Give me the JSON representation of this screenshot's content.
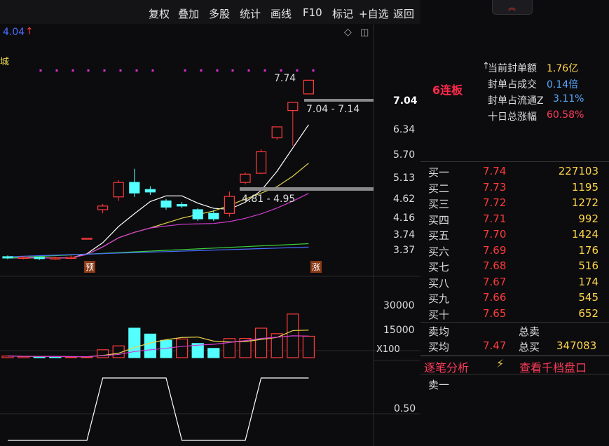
{
  "toolbar": {
    "items": [
      "复权",
      "叠加",
      "多股",
      "统计",
      "画线",
      "F10",
      "标记",
      "+自选",
      "返回"
    ]
  },
  "chart": {
    "top_price_label": "4.04",
    "top_left_char": "城",
    "price_ticks": [
      "7.04",
      "6.34",
      "5.70",
      "5.13",
      "4.62",
      "4.16",
      "3.74",
      "3.37"
    ],
    "annotation_high": "7.74",
    "range_label_1": "7.04 - 7.14",
    "range_label_2": "4.81 - 4.95",
    "marker_yu": "预",
    "marker_zhang": "涨",
    "volume_ticks": [
      "30000",
      "15000"
    ],
    "volume_unit": "X100",
    "indicator_tick": "0.50",
    "colors": {
      "up": "#ff3b3b",
      "down": "#54ffff",
      "ma5": "#ffffff",
      "ma10": "#e6d44a",
      "ma20": "#d23cd2",
      "ma60": "#3cd23c",
      "ma120": "#4a6cff",
      "dots": "#e030e0"
    }
  },
  "chart_data": {
    "type": "candlestick",
    "title": "",
    "candles": [
      {
        "open": 3.64,
        "close": 3.62,
        "high": 3.66,
        "low": 3.6
      },
      {
        "open": 3.62,
        "close": 3.63,
        "high": 3.65,
        "low": 3.6
      },
      {
        "open": 3.63,
        "close": 3.61,
        "high": 3.64,
        "low": 3.59
      },
      {
        "open": 3.61,
        "close": 3.62,
        "high": 3.64,
        "low": 3.59
      },
      {
        "open": 3.62,
        "close": 3.63,
        "high": 3.66,
        "low": 3.6
      },
      {
        "open": 3.94,
        "close": 3.94,
        "high": 3.94,
        "low": 3.94
      },
      {
        "open": 4.45,
        "close": 4.52,
        "high": 4.56,
        "low": 4.38
      },
      {
        "open": 4.7,
        "close": 5.0,
        "high": 5.05,
        "low": 4.62
      },
      {
        "open": 5.0,
        "close": 4.78,
        "high": 5.3,
        "low": 4.7
      },
      {
        "open": 4.85,
        "close": 4.8,
        "high": 4.92,
        "low": 4.74
      },
      {
        "open": 4.62,
        "close": 4.5,
        "high": 4.66,
        "low": 4.45
      },
      {
        "open": 4.55,
        "close": 4.52,
        "high": 4.6,
        "low": 4.48
      },
      {
        "open": 4.45,
        "close": 4.28,
        "high": 4.48,
        "low": 4.24
      },
      {
        "open": 4.38,
        "close": 4.28,
        "high": 4.44,
        "low": 4.24
      },
      {
        "open": 4.38,
        "close": 4.71,
        "high": 4.81,
        "low": 4.32
      },
      {
        "open": 5.0,
        "close": 5.18,
        "high": 5.22,
        "low": 4.96
      },
      {
        "open": 5.2,
        "close": 5.7,
        "high": 5.76,
        "low": 5.18
      },
      {
        "open": 6.05,
        "close": 6.34,
        "high": 6.34,
        "low": 6.0
      },
      {
        "open": 6.8,
        "close": 7.04,
        "high": 7.04,
        "low": 5.85
      },
      {
        "open": 7.3,
        "close": 7.74,
        "high": 7.74,
        "low": 7.3
      }
    ],
    "volume": [
      8,
      6,
      4,
      5,
      4,
      3,
      40,
      60,
      150,
      120,
      88,
      95,
      72,
      47,
      97,
      98,
      150,
      122,
      222,
      109
    ],
    "volume_up": [
      true,
      true,
      false,
      false,
      true,
      true,
      true,
      true,
      false,
      false,
      false,
      true,
      false,
      false,
      true,
      true,
      true,
      true,
      true,
      true
    ],
    "indicator": [
      0,
      0,
      0,
      0,
      0,
      0,
      1,
      1,
      1,
      1,
      1,
      0,
      0,
      0,
      0,
      0,
      1,
      1,
      1,
      1
    ]
  },
  "panel": {
    "status_title": "6连板",
    "stats": [
      {
        "label": "当前封单额",
        "value": "1.76亿",
        "value_color": "#ffd54a"
      },
      {
        "label": "封单占成交",
        "value": "0.14倍",
        "value_color": "#58a8ff"
      },
      {
        "label": "封单占流通Z",
        "value": "3.11%",
        "value_color": "#58a8ff"
      },
      {
        "label": "十日总涨幅",
        "value": "60.58%",
        "value_color": "#ff3b5b"
      }
    ],
    "orders": [
      {
        "label": "买一",
        "price": "7.74",
        "vol": "227103"
      },
      {
        "label": "买二",
        "price": "7.73",
        "vol": "1195"
      },
      {
        "label": "买三",
        "price": "7.72",
        "vol": "1272"
      },
      {
        "label": "买四",
        "price": "7.71",
        "vol": "992"
      },
      {
        "label": "买五",
        "price": "7.70",
        "vol": "1424"
      },
      {
        "label": "买六",
        "price": "7.69",
        "vol": "176"
      },
      {
        "label": "买七",
        "price": "7.68",
        "vol": "516"
      },
      {
        "label": "买八",
        "price": "7.67",
        "vol": "174"
      },
      {
        "label": "买九",
        "price": "7.66",
        "vol": "545"
      },
      {
        "label": "买十",
        "price": "7.65",
        "vol": "652"
      }
    ],
    "sell_avg_label": "卖均",
    "total_sell_label": "总卖",
    "buy_avg_label": "买均",
    "buy_avg_value": "7.47",
    "total_buy_label": "总买",
    "total_buy_value": "347083",
    "tab_tick_analysis": "逐笔分析",
    "tab_view_depth": "查看千档盘口",
    "sell_one": "卖一"
  }
}
